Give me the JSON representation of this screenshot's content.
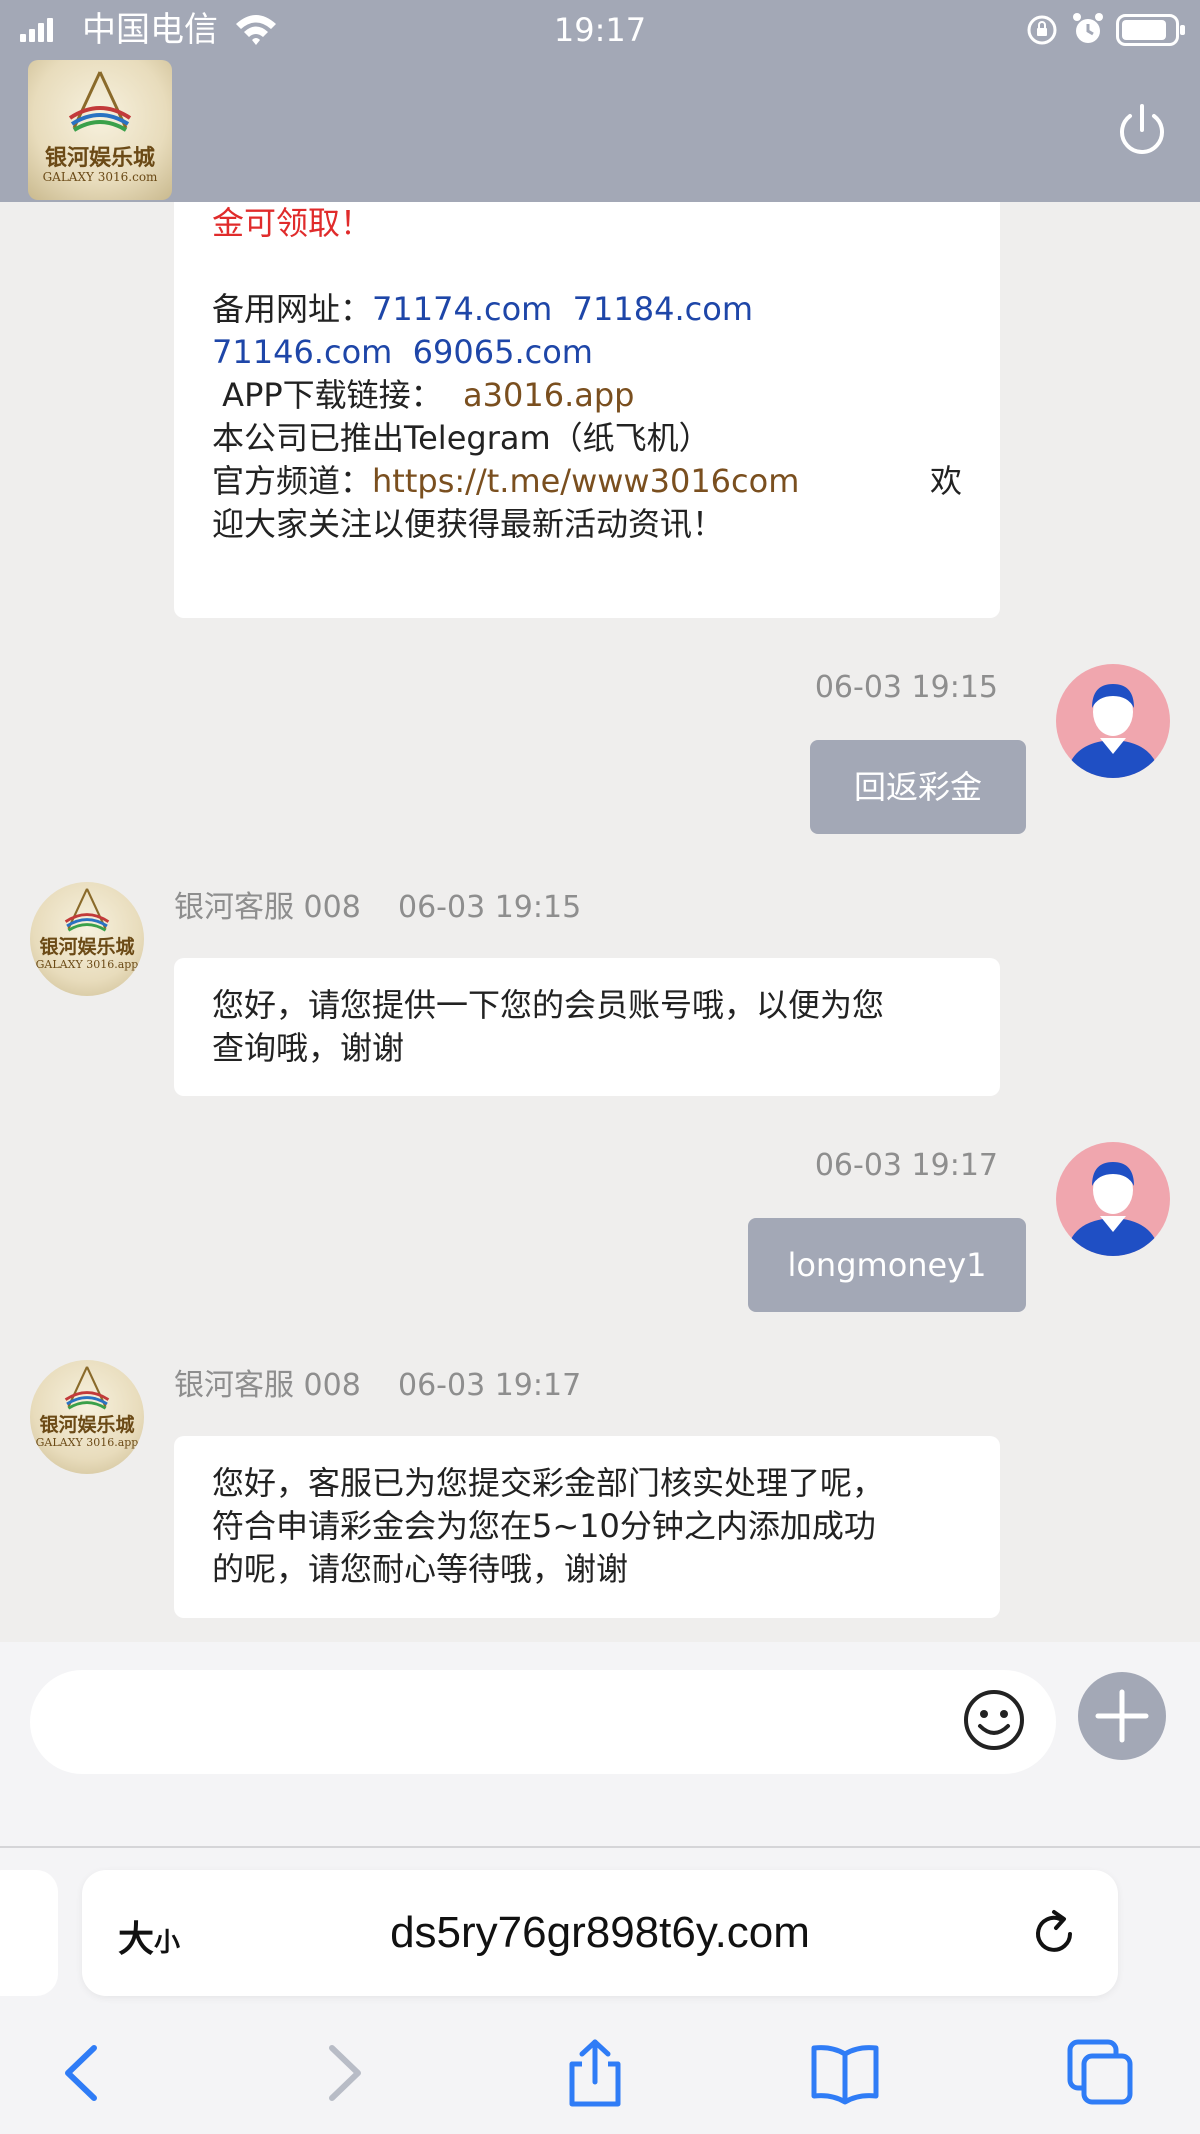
{
  "status_bar": {
    "carrier": "中国电信",
    "time": "19:17",
    "icons": [
      "signal-icon",
      "wifi-icon",
      "orientation-lock-icon",
      "alarm-icon",
      "battery-icon"
    ]
  },
  "header": {
    "logo_text_cn": "银河娱乐城",
    "logo_text_en": "GALAXY 3016.com",
    "power_icon": "power-icon"
  },
  "messages": {
    "first": {
      "line1": "金可领取！",
      "backup_label": "备用网址：",
      "url1": "71174.com",
      "url2": "71184.com",
      "url3": "71146.com",
      "url4": "69065.com",
      "app_label": "APP下载链接：",
      "app_link": "a3016.app",
      "telegram_line": "本公司已推出Telegram（纸飞机）",
      "channel_label": "官方频道：",
      "channel_link": "https://t.me/www3016com",
      "channel_tail": "欢",
      "last_line": "迎大家关注以便获得最新活动资讯！"
    },
    "user1": {
      "time": "06-03 19:15",
      "text": "回返彩金"
    },
    "cs1": {
      "sender": "银河客服 008",
      "time": "06-03 19:15",
      "line1": "您好，请您提供一下您的会员账号哦，以便为您",
      "line2": "查询哦，谢谢"
    },
    "user2": {
      "time": "06-03 19:17",
      "text": "longmoney1"
    },
    "cs2": {
      "sender": "银河客服 008",
      "time": "06-03 19:17",
      "line1": "您好，客服已为您提交彩金部门核实处理了呢，",
      "line2": "符合申请彩金会为您在5~10分钟之内添加成功",
      "line3": "的呢，请您耐心等待哦，谢谢"
    },
    "cs_avatar_cn": "银河娱乐城",
    "cs_avatar_en": "GALAXY 3016.app"
  },
  "input": {
    "placeholder": "",
    "emoji_icon": "smiley-icon",
    "plus_icon": "plus-icon"
  },
  "browser": {
    "text_size_big": "大",
    "text_size_small": "小",
    "url": "ds5ry76gr898t6y.com",
    "nav_icons": [
      "back-icon",
      "forward-icon",
      "share-icon",
      "bookmarks-icon",
      "tabs-icon"
    ]
  },
  "colors": {
    "header_bg": "#a3a8b6",
    "chat_bg": "#efeeed",
    "red_text": "#e02b2b",
    "link_blue": "#1e46a8",
    "link_brown": "#7a4f1f",
    "browser_blue": "#2f7cf6"
  }
}
